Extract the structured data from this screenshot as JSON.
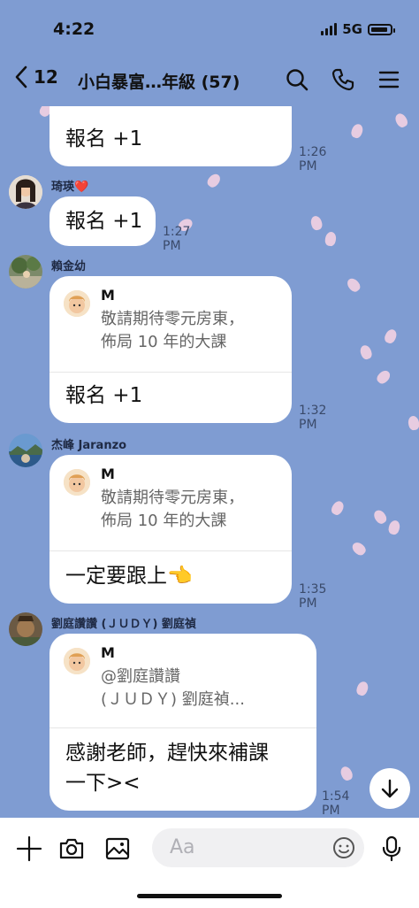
{
  "status_bar": {
    "time": "4:22",
    "network": "5G"
  },
  "header": {
    "back_count": "12",
    "title": "小白暴富…年級 (57)"
  },
  "messages": [
    {
      "sender": "",
      "text": "報名 +1",
      "time": "1:26 PM"
    },
    {
      "sender": "琦瑛❤️",
      "text": "報名 +1",
      "time": "1:27 PM"
    },
    {
      "sender": "賴金幼",
      "reply_name": "M",
      "reply_text": "敬請期待零元房東，\n佈局 10 年的大課",
      "text": "報名 +1",
      "time": "1:32 PM"
    },
    {
      "sender": "杰峰 Jaranzo",
      "reply_name": "M",
      "reply_text": "敬請期待零元房東，\n佈局 10 年的大課",
      "text": "一定要跟上👈",
      "time": "1:35 PM"
    },
    {
      "sender": "劉庭讚讚 (ＪＵＤＹ) 劉庭禎",
      "reply_name": "M",
      "reply_text": "@劉庭讚讚\n(ＪＵＤＹ) 劉庭禎...",
      "text": "感謝老師，趕快來補課\n一下><",
      "time": "1:54 PM"
    }
  ],
  "input": {
    "placeholder": "Aa"
  },
  "colors": {
    "chat_background": "#7f9cd2",
    "bubble": "#ffffff",
    "petal": "#f3d2e2"
  },
  "icons": [
    "back-icon",
    "search-icon",
    "phone-icon",
    "menu-icon",
    "scroll-down-icon",
    "plus-icon",
    "camera-icon",
    "image-icon",
    "emoji-icon",
    "microphone-icon"
  ]
}
